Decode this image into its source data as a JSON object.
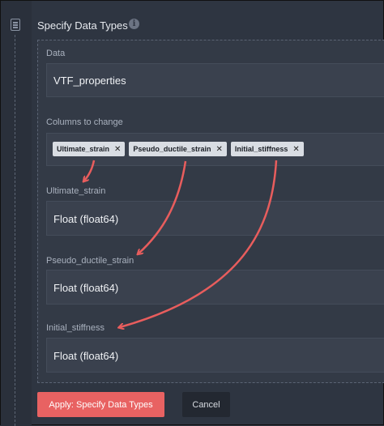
{
  "header": {
    "title": "Specify Data Types",
    "info_icon": "info-icon"
  },
  "data_section": {
    "label": "Data",
    "value": "VTF_properties"
  },
  "columns_section": {
    "label": "Columns to change",
    "tags": [
      "Ultimate_strain",
      "Pseudo_ductile_strain",
      "Initial_stiffness"
    ],
    "remove_glyph": "✕"
  },
  "type_fields": [
    {
      "label": "Ultimate_strain",
      "value": "Float (float64)"
    },
    {
      "label": "Pseudo_ductile_strain",
      "value": "Float (float64)"
    },
    {
      "label": "Initial_stiffness",
      "value": "Float (float64)"
    }
  ],
  "buttons": {
    "apply": "Apply: Specify Data Types",
    "cancel": "Cancel"
  },
  "colors": {
    "accent": "#e86262",
    "arrow": "#e85d5d",
    "background": "#2e3541"
  }
}
